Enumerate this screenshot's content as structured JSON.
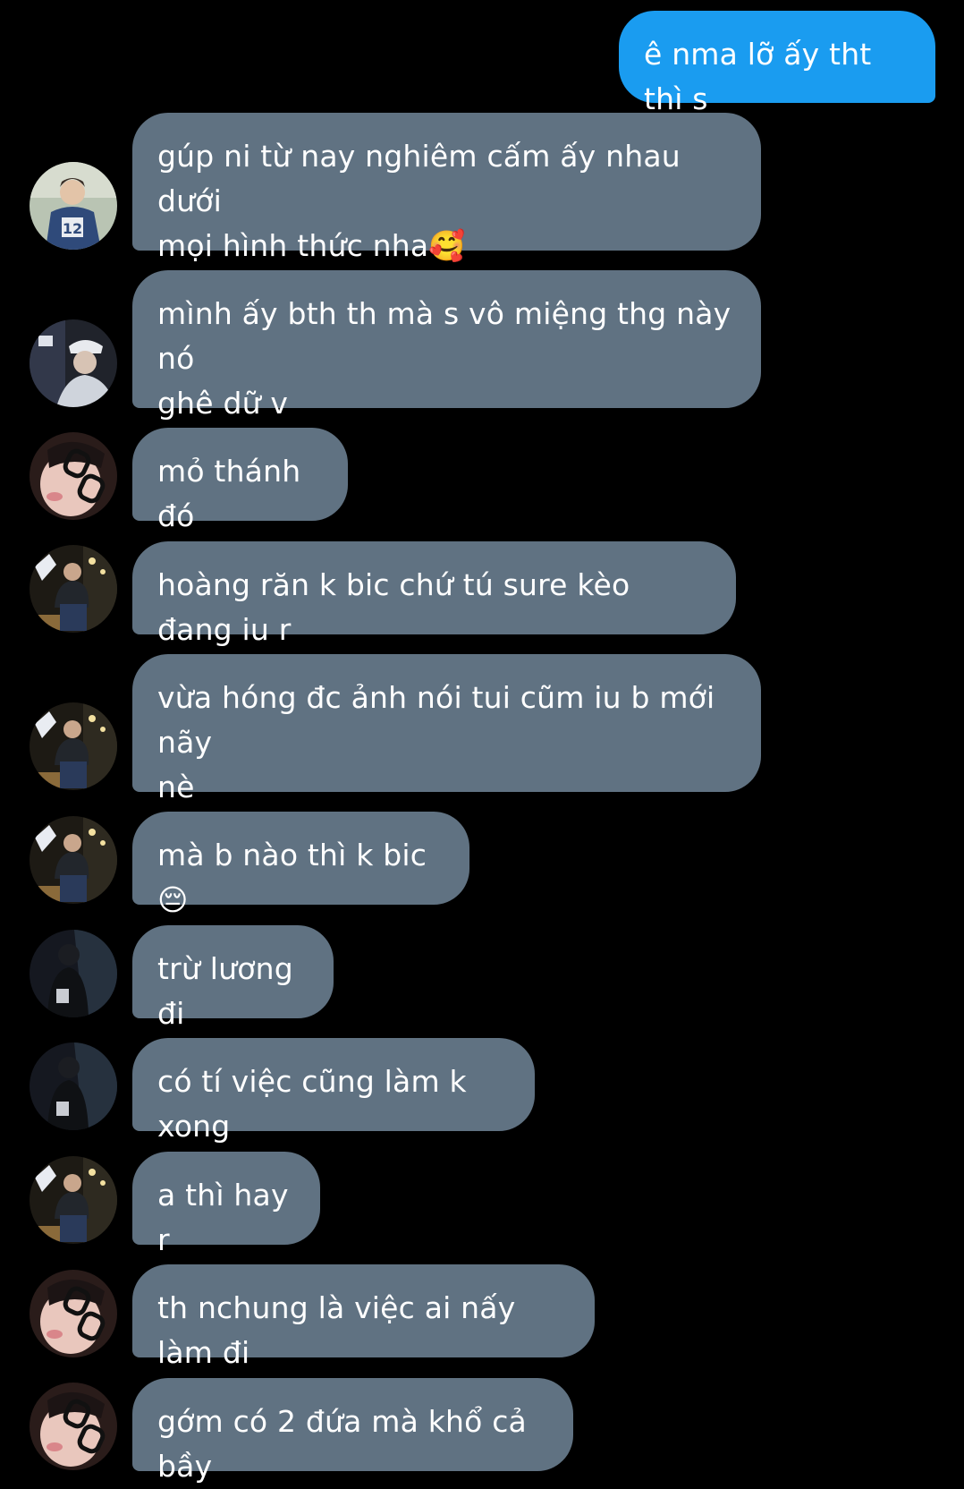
{
  "colors": {
    "background": "#000000",
    "incoming_bubble": "#607282",
    "outgoing_bubble": "#1a9cf0",
    "text": "#ffffff"
  },
  "messages": [
    {
      "direction": "outgoing",
      "text": "ê nma lỡ ấy tht thì s"
    },
    {
      "direction": "incoming",
      "avatar": "avatar-jersey",
      "text": "gúp ni từ nay nghiêm cấm ấy nhau dưới\nmọi hình thức nha🥰"
    },
    {
      "direction": "incoming",
      "avatar": "avatar-cap",
      "text": "mình ấy bth th mà s vô miệng thg này nó\nghê dữ v"
    },
    {
      "direction": "incoming",
      "avatar": "avatar-glasses",
      "text": "mỏ thánh đó"
    },
    {
      "direction": "incoming",
      "avatar": "avatar-street",
      "text": "hoàng răn k bic chứ tú sure kèo đang iu r"
    },
    {
      "direction": "incoming",
      "avatar": "avatar-street",
      "text": "vừa hóng đc ảnh nói tui cũm iu b mới nãy\nnè"
    },
    {
      "direction": "incoming",
      "avatar": "avatar-street",
      "text": "mà b nào thì k bic😔"
    },
    {
      "direction": "incoming",
      "avatar": "avatar-dark",
      "text": "trừ lương đi"
    },
    {
      "direction": "incoming",
      "avatar": "avatar-dark",
      "text": "có tí việc cũng làm k xong"
    },
    {
      "direction": "incoming",
      "avatar": "avatar-street",
      "text": "a thì hay r"
    },
    {
      "direction": "incoming",
      "avatar": "avatar-glasses",
      "text": "th nchung là việc ai nấy làm đi"
    },
    {
      "direction": "incoming",
      "avatar": "avatar-glasses",
      "text": "gớm có 2 đứa mà khổ cả bầy"
    }
  ]
}
